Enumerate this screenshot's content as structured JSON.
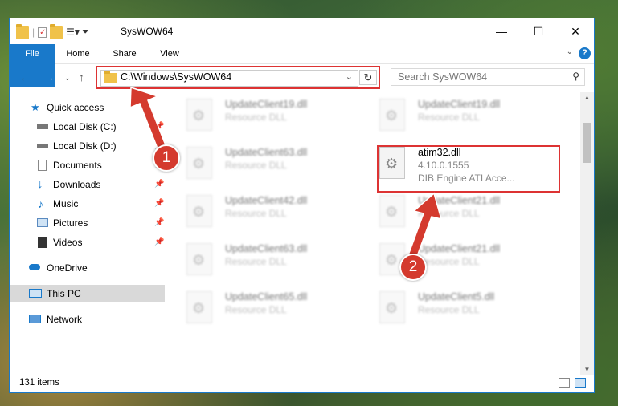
{
  "window": {
    "title": "SysWOW64",
    "minimize": "—",
    "maximize": "☐",
    "close": "✕"
  },
  "ribbon": {
    "tabs": [
      "File",
      "Home",
      "Share",
      "View"
    ],
    "help": "?"
  },
  "address": {
    "path": "C:\\Windows\\SysWOW64"
  },
  "search": {
    "placeholder": "Search SysWOW64"
  },
  "sidebar": {
    "items": [
      {
        "label": "Quick access",
        "icon": "star-icon"
      },
      {
        "label": "Local Disk (C:)",
        "icon": "drive-icon"
      },
      {
        "label": "Local Disk (D:)",
        "icon": "drive-icon"
      },
      {
        "label": "Documents",
        "icon": "documents-icon"
      },
      {
        "label": "Downloads",
        "icon": "download-icon"
      },
      {
        "label": "Music",
        "icon": "music-icon"
      },
      {
        "label": "Pictures",
        "icon": "pictures-icon"
      },
      {
        "label": "Videos",
        "icon": "videos-icon"
      },
      {
        "label": "OneDrive",
        "icon": "cloud-icon"
      },
      {
        "label": "This PC",
        "icon": "computer-icon"
      },
      {
        "label": "Network",
        "icon": "network-icon"
      }
    ]
  },
  "files": [
    {
      "name": "UpdateClient19.dll",
      "type": "Resource DLL"
    },
    {
      "name": "UpdateClient19.dll",
      "type": "Resource DLL"
    },
    {
      "name": "UpdateClient63.dll",
      "type": "Resource DLL"
    },
    {
      "name": "atim32.dll",
      "version": "4.10.0.1555",
      "description": "DIB Engine ATI Acce..."
    },
    {
      "name": "UpdateClient42.dll",
      "type": "Resource DLL"
    },
    {
      "name": "UpdateClient21.dll",
      "type": "Resource DLL"
    },
    {
      "name": "UpdateClient63.dll",
      "type": "Resource DLL"
    },
    {
      "name": "UpdateClient21.dll",
      "type": "Resource DLL"
    },
    {
      "name": "UpdateClient65.dll",
      "type": "Resource DLL"
    },
    {
      "name": "UpdateClient5.dll",
      "type": "Resource DLL"
    }
  ],
  "status": {
    "count": "131 items"
  },
  "callouts": [
    "1",
    "2"
  ],
  "colors": {
    "accent": "#1979ca",
    "callout": "#d43a2e"
  }
}
